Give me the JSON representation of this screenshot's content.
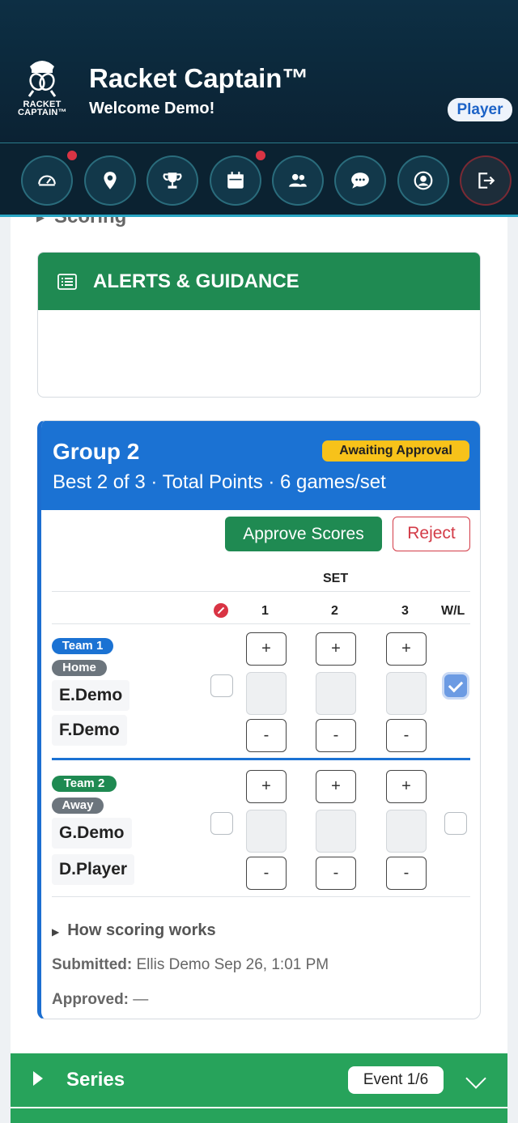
{
  "header": {
    "app_title": "Racket Captain™",
    "welcome": "Welcome Demo!",
    "role_badge": "Player",
    "logo_text_1": "RACKET",
    "logo_text_2": "CAPTAIN™"
  },
  "nav": {
    "items": [
      {
        "icon": "dashboard-gauge-icon",
        "badge": true
      },
      {
        "icon": "location-pin-icon",
        "badge": false
      },
      {
        "icon": "trophy-icon",
        "badge": false
      },
      {
        "icon": "calendar-icon",
        "badge": true
      },
      {
        "icon": "people-icon",
        "badge": false
      },
      {
        "icon": "chat-bubble-icon",
        "badge": false
      },
      {
        "icon": "user-circle-icon",
        "badge": false
      },
      {
        "icon": "logout-icon",
        "badge": false
      }
    ]
  },
  "scoring_peek": "Scoring",
  "alerts": {
    "title": "ALERTS & GUIDANCE"
  },
  "group": {
    "title": "Group 2",
    "subtitle": "Best 2 of 3 · Total Points · 6 games/set",
    "status_badge": "Awaiting Approval",
    "approve_label": "Approve Scores",
    "reject_label": "Reject",
    "set_header": "SET",
    "columns": [
      "1",
      "2",
      "3",
      "W/L"
    ],
    "teams": [
      {
        "label": "Team 1",
        "side": "Home",
        "players": [
          "E.Demo",
          "F.Demo"
        ],
        "winner_checked": true,
        "forfeit_checked": false,
        "scores": [
          "",
          "",
          ""
        ]
      },
      {
        "label": "Team 2",
        "side": "Away",
        "players": [
          "G.Demo",
          "D.Player"
        ],
        "winner_checked": false,
        "forfeit_checked": false,
        "scores": [
          "",
          "",
          ""
        ]
      }
    ],
    "plus_label": "+",
    "minus_label": "-",
    "how_scoring": "How scoring works",
    "submitted_label": "Submitted:",
    "submitted_value": "Ellis Demo  Sep 26, 1:01 PM",
    "approved_label": "Approved:",
    "approved_value": "—"
  },
  "series": {
    "title": "Series",
    "badge": "Event 1/6"
  },
  "colors": {
    "header_bg": "#0d2f44",
    "green": "#1f8a52",
    "blue": "#1b72d3",
    "yellow": "#f7c21a",
    "red": "#d93444"
  }
}
